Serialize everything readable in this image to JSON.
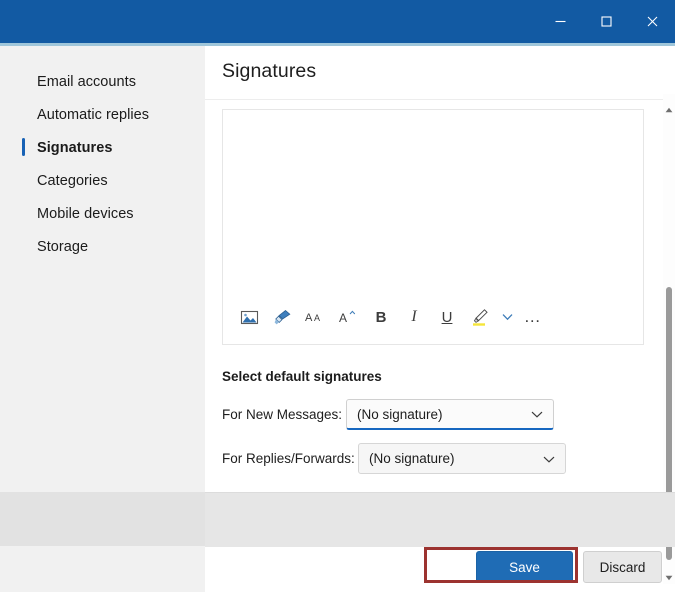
{
  "window": {
    "titlebar_color": "#125aa3",
    "controls": [
      {
        "name": "minimize",
        "label": "Minimize",
        "glyph": "minimize-icon"
      },
      {
        "name": "maximize",
        "label": "Maximize",
        "glyph": "maximize-icon"
      },
      {
        "name": "close",
        "label": "Close",
        "glyph": "close-icon"
      }
    ]
  },
  "sidebar": {
    "items": [
      {
        "label": "Email accounts",
        "selected": false
      },
      {
        "label": "Automatic replies",
        "selected": false
      },
      {
        "label": "Signatures",
        "selected": true
      },
      {
        "label": "Categories",
        "selected": false
      },
      {
        "label": "Mobile devices",
        "selected": false
      },
      {
        "label": "Storage",
        "selected": false
      }
    ],
    "selected_indicator_color": "#1862b5"
  },
  "main": {
    "title": "Signatures",
    "editor": {
      "content": "",
      "toolbar": [
        {
          "name": "insert-picture",
          "label": "Insert picture"
        },
        {
          "name": "format-painter",
          "label": "Format painter"
        },
        {
          "name": "grow-font",
          "label": "Grow font"
        },
        {
          "name": "shrink-font",
          "label": "Shrink font"
        },
        {
          "name": "bold",
          "label": "B"
        },
        {
          "name": "italic",
          "label": "I"
        },
        {
          "name": "underline",
          "label": "U"
        },
        {
          "name": "text-highlight",
          "label": "Text highlight color"
        },
        {
          "name": "highlight-dropdown",
          "label": "More highlight colors"
        },
        {
          "name": "more-options",
          "label": "…"
        }
      ]
    },
    "defaults_section": {
      "heading": "Select default signatures",
      "fields": [
        {
          "label": "For New Messages:",
          "value": "(No signature)",
          "focused": true,
          "options": [
            "(No signature)"
          ]
        },
        {
          "label": "For Replies/Forwards:",
          "value": "(No signature)",
          "focused": false,
          "options": [
            "(No signature)"
          ]
        }
      ]
    }
  },
  "footer": {
    "save_label": "Save",
    "discard_label": "Discard",
    "save_color": "#1f6cb5",
    "annotation_color": "#9c3330"
  },
  "scrollbar": {
    "up_arrow": "▲",
    "down_arrow": "▼"
  }
}
